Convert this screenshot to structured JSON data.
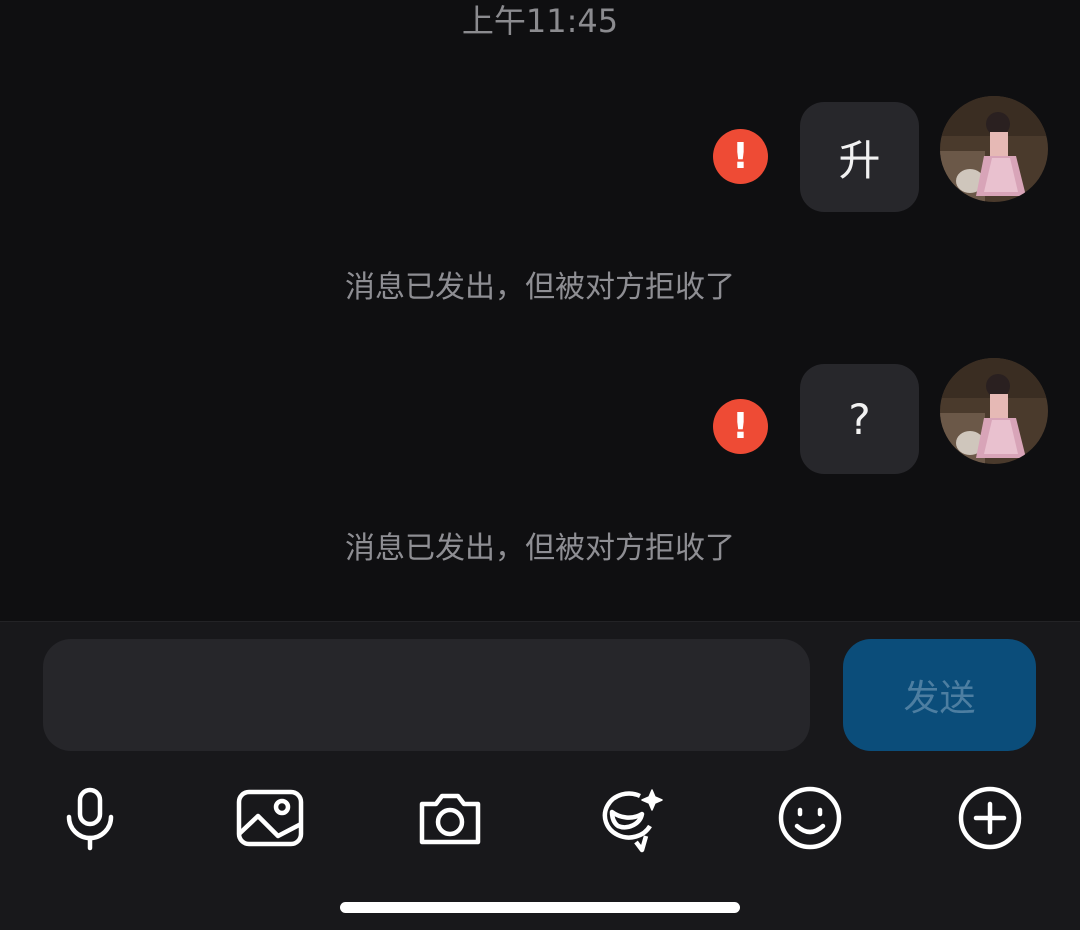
{
  "header": {
    "timestamp": "上午11:45"
  },
  "messages": [
    {
      "text": "升",
      "status_notice": "消息已发出，但被对方拒收了"
    },
    {
      "text": "?",
      "status_notice": "消息已发出，但被对方拒收了"
    }
  ],
  "error_badge_glyph": "!",
  "composer": {
    "input_value": "",
    "input_placeholder": "",
    "send_label": "发送"
  },
  "toolbar": {
    "icons": [
      "microphone-icon",
      "image-icon",
      "camera-icon",
      "ai-sticker-icon",
      "emoji-icon",
      "plus-icon"
    ]
  },
  "colors": {
    "background": "#0f0f11",
    "bubble": "#27272b",
    "error": "#ee4b35",
    "send_button": "#0b4d7a",
    "notice_text": "#8e8e93"
  }
}
